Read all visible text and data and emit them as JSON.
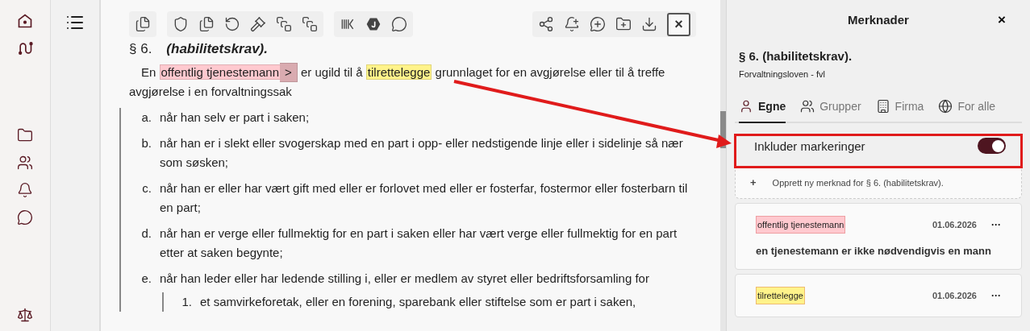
{
  "toolbar": {
    "close_label": "×"
  },
  "section": {
    "number": "§ 6.",
    "title": "(habilitetskrav)."
  },
  "paragraph": {
    "segments": [
      {
        "kind": "text",
        "text": "En "
      },
      {
        "kind": "mark",
        "text": "offentlig tjenestemann",
        "color": "#ffc9cf",
        "expand_label": ">"
      },
      {
        "kind": "text",
        "text": " er ugild til å "
      },
      {
        "kind": "mark",
        "text": "tilrettelegge",
        "color": "#fff38a"
      },
      {
        "kind": "text",
        "text": " grunnlaget for en avgjørelse eller til å treffe avgjørelse i en forvaltningssak"
      }
    ]
  },
  "items": [
    {
      "label": "a.",
      "text": "når han selv er part i saken;"
    },
    {
      "label": "b.",
      "text": "når han er i slekt eller svogerskap med en part i opp- eller nedstigende linje eller i sidelinje så nær som søsken;"
    },
    {
      "label": "c.",
      "text": "når han er eller har vært gift med eller er forlovet med eller er fosterfar, fostermor eller fosterbarn til en part;"
    },
    {
      "label": "d.",
      "text": "når han er verge eller fullmektig for en part i saken eller har vært verge eller fullmektig for en part etter at saken begynte;"
    },
    {
      "label": "e.",
      "text": "når han leder eller har ledende stilling i, eller er medlem av styret eller bedriftsforsamling for",
      "children": [
        {
          "label": "1.",
          "text": "et samvirkeforetak, eller en forening, sparebank eller stiftelse som er part i saken,"
        }
      ]
    }
  ],
  "panel": {
    "title": "Merknader",
    "close_label": "×",
    "heading": "§ 6. (habilitetskrav).",
    "subtitle": "Forvaltningsloven - fvl",
    "tabs": [
      {
        "kind": "user",
        "label": "Egne",
        "selected": true
      },
      {
        "kind": "users",
        "label": "Grupper",
        "selected": false
      },
      {
        "kind": "building",
        "label": "Firma",
        "selected": false
      },
      {
        "kind": "globe",
        "label": "For alle",
        "selected": false
      }
    ],
    "toggle": {
      "label": "Inkluder markeringer",
      "on": true
    },
    "create": {
      "icon_label": "+",
      "text": "Opprett ny merknad for § 6. (habilitetskrav)."
    },
    "notes": [
      {
        "tag": "offentlig tjenestemann",
        "color": "#ffc9cf",
        "date": "01.06.2026",
        "menu_label": "···",
        "text": "en tjenestemann er ikke nødvendigvis en mann"
      },
      {
        "tag": "tilrettelegge",
        "color": "#fff38a",
        "date": "01.06.2026",
        "menu_label": "···"
      }
    ]
  }
}
